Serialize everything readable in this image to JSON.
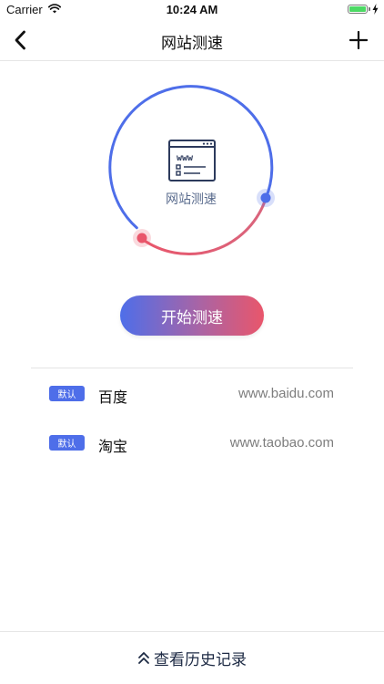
{
  "status_bar": {
    "carrier": "Carrier",
    "time": "10:24 AM"
  },
  "nav": {
    "title": "网站测速",
    "back_icon": "chevron-left-icon",
    "add_icon": "plus-icon"
  },
  "gauge": {
    "label": "网站测速",
    "icon": "website-www-icon"
  },
  "start_button": {
    "label": "开始测速"
  },
  "sites": [
    {
      "badge": "默认",
      "name": "百度",
      "url": "www.baidu.com"
    },
    {
      "badge": "默认",
      "name": "淘宝",
      "url": "www.taobao.com"
    }
  ],
  "history": {
    "label": "查看历史记录",
    "icon": "double-chevron-up-icon"
  },
  "colors": {
    "accent_blue": "#4e6ee9",
    "accent_red": "#e9566b",
    "battery_green": "#4cd964"
  }
}
